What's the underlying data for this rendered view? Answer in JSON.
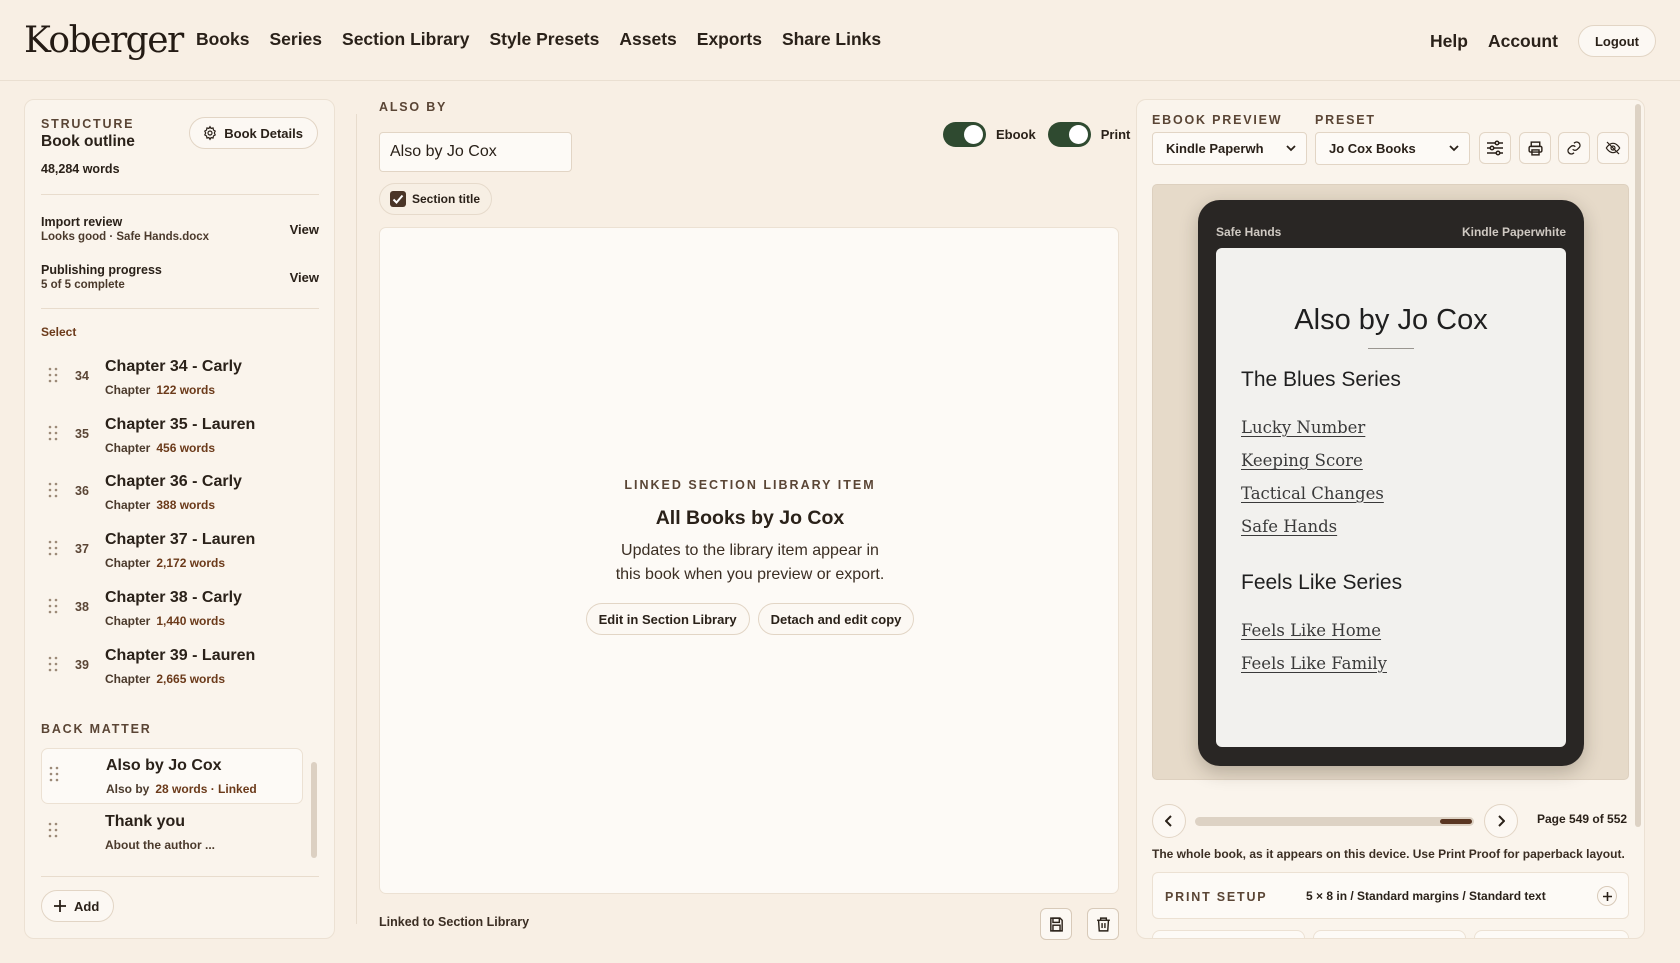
{
  "header": {
    "logo": "Koberger",
    "nav": [
      "Books",
      "Series",
      "Section Library",
      "Style Presets",
      "Assets",
      "Exports",
      "Share Links"
    ],
    "help": "Help",
    "account": "Account",
    "logout": "Logout"
  },
  "left": {
    "eyebrow": "STRUCTURE",
    "title": "Book outline",
    "words": "48,284 words",
    "book_details": "Book Details",
    "import": {
      "title": "Import review",
      "sub": "Looks good · Safe Hands.docx",
      "action": "View"
    },
    "progress": {
      "title": "Publishing progress",
      "sub": "5 of 5 complete",
      "action": "View"
    },
    "select": "Select",
    "chapters": [
      {
        "num": "34",
        "name": "Chapter 34 - Carly",
        "type": "Chapter",
        "words": "122 words"
      },
      {
        "num": "35",
        "name": "Chapter 35 - Lauren",
        "type": "Chapter",
        "words": "456 words"
      },
      {
        "num": "36",
        "name": "Chapter 36 - Carly",
        "type": "Chapter",
        "words": "388 words"
      },
      {
        "num": "37",
        "name": "Chapter 37 - Lauren",
        "type": "Chapter",
        "words": "2,172 words"
      },
      {
        "num": "38",
        "name": "Chapter 38 - Carly",
        "type": "Chapter",
        "words": "1,440 words"
      },
      {
        "num": "39",
        "name": "Chapter 39 - Lauren",
        "type": "Chapter",
        "words": "2,665 words"
      }
    ],
    "back_matter_label": "BACK MATTER",
    "back_matter": [
      {
        "name": "Also by Jo Cox",
        "type": "Also by",
        "words": "28 words · Linked"
      },
      {
        "name": "Thank you",
        "type": "About the author ...",
        "words": ""
      }
    ],
    "add": "Add"
  },
  "editor": {
    "eyebrow": "ALSO BY",
    "title_value": "Also by Jo Cox",
    "section_title_label": "Section title",
    "section_title_checked": true,
    "ebook_label": "Ebook",
    "print_label": "Print",
    "ebook_on": true,
    "print_on": true,
    "linked": {
      "eyebrow": "LINKED SECTION LIBRARY ITEM",
      "title": "All Books by Jo Cox",
      "body_line1": "Updates to the library item appear in",
      "body_line2": "this book when you preview or export.",
      "edit": "Edit in Section Library",
      "detach": "Detach and edit copy"
    },
    "footer_note": "Linked to Section Library"
  },
  "preview": {
    "ebook_label": "EBOOK PREVIEW",
    "device_value": "Kindle Paperwh",
    "preset_label": "PRESET",
    "preset_value": "Jo Cox Books",
    "device_book": "Safe Hands",
    "device_name": "Kindle Paperwhite",
    "screen": {
      "title": "Also by Jo Cox",
      "series1": "The Blues Series",
      "series1_books": [
        "Lucky Number",
        "Keeping Score",
        "Tactical Changes",
        "Safe Hands"
      ],
      "series2": "Feels Like Series",
      "series2_books": [
        "Feels Like Home",
        "Feels Like Family"
      ]
    },
    "page": "Page 549 of 552",
    "page_current": 549,
    "page_total": 552,
    "note": "The whole book, as it appears on this device. Use Print Proof for paperback layout.",
    "print_setup_label": "PRINT SETUP",
    "print_setup_value": "5 × 8 in / Standard margins / Standard text"
  },
  "colors": {
    "background": "#f8efe4",
    "toggle_on": "#2f4a30",
    "accent_brown": "#6b3a1a",
    "device": "#292624"
  }
}
